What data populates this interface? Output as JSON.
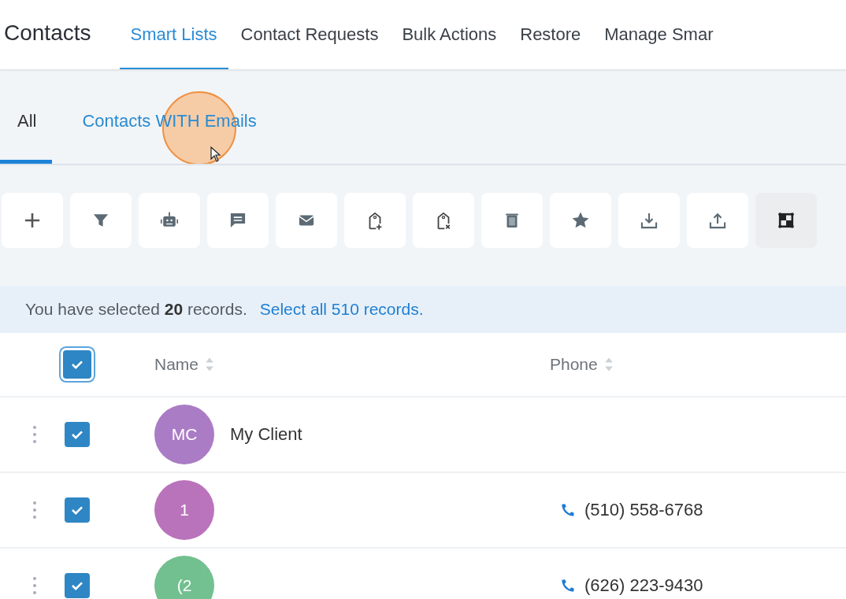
{
  "header": {
    "title": "Contacts",
    "tabs": [
      {
        "label": "Smart Lists",
        "selected": true
      },
      {
        "label": "Contact Requests",
        "selected": false
      },
      {
        "label": "Bulk Actions",
        "selected": false
      },
      {
        "label": "Restore",
        "selected": false
      },
      {
        "label": "Manage Smar",
        "selected": false
      }
    ]
  },
  "subtabs": [
    {
      "label": "All",
      "selected": true
    },
    {
      "label": "Contacts WITH Emails",
      "selected": false
    }
  ],
  "toolbar": [
    {
      "kind": "add",
      "selected": false
    },
    {
      "kind": "filter",
      "selected": false
    },
    {
      "kind": "robot",
      "selected": false
    },
    {
      "kind": "message",
      "selected": false
    },
    {
      "kind": "email",
      "selected": false
    },
    {
      "kind": "tag-add",
      "selected": false
    },
    {
      "kind": "tag-remove",
      "selected": false
    },
    {
      "kind": "delete",
      "selected": false
    },
    {
      "kind": "star",
      "selected": false
    },
    {
      "kind": "import",
      "selected": false
    },
    {
      "kind": "export",
      "selected": false
    },
    {
      "kind": "merge",
      "selected": true
    }
  ],
  "selection_banner": {
    "text": "You have selected **20** records.",
    "link": "Select all 510 records."
  },
  "table": {
    "select_all_checked": true,
    "columns": [
      "Name",
      "Phone"
    ],
    "rows": [
      {
        "checked": true,
        "initials": "MC",
        "color": "#a675c2",
        "name": "My Client"
      },
      {
        "checked": true,
        "initials": "1",
        "color": "#b66cb8",
        "phone": "(510) 558-6768"
      },
      {
        "checked": true,
        "initials": "(2",
        "color": "#6bbd8a",
        "phone": "(626) 223-9430"
      }
    ]
  }
}
